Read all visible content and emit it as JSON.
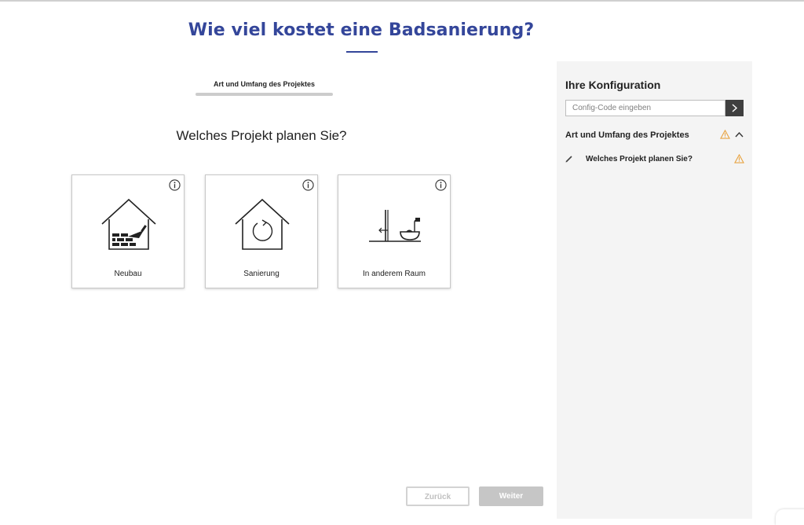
{
  "page": {
    "title": "Wie viel kostet eine Badsanierung?",
    "step_label": "Art und Umfang des Projektes",
    "question": "Welches Projekt planen Sie?"
  },
  "options": [
    {
      "label": "Neubau",
      "icon": "house-bricks-trowel-icon"
    },
    {
      "label": "Sanierung",
      "icon": "house-refresh-icon"
    },
    {
      "label": "In anderem Raum",
      "icon": "bath-relocate-icon"
    }
  ],
  "nav": {
    "back_label": "Zurück",
    "next_label": "Weiter"
  },
  "sidebar": {
    "title": "Ihre Konfiguration",
    "config_placeholder": "Config-Code eingeben",
    "section_title": "Art und Umfang des Projektes",
    "items": [
      {
        "label": "Welches Projekt planen Sie?"
      }
    ]
  },
  "colors": {
    "brand": "#34469a",
    "warning": "#e8a443",
    "button_disabled": "#c6c6c6"
  }
}
